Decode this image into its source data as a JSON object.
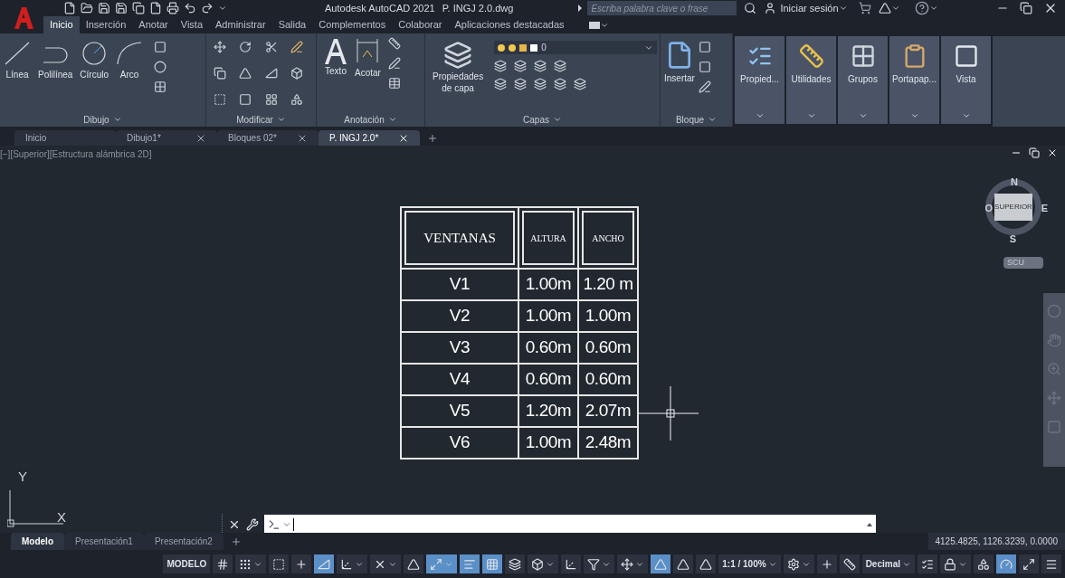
{
  "window": {
    "app_title": "Autodesk AutoCAD 2021",
    "file_name": "P. INGJ 2.0.dwg",
    "search_placeholder": "Escriba palabra clave o frase",
    "sign_in": "Iniciar sesión"
  },
  "ribbon_tabs": [
    {
      "label": "Inicio",
      "selected": true
    },
    {
      "label": "Inserción",
      "selected": false
    },
    {
      "label": "Anotar",
      "selected": false
    },
    {
      "label": "Vista",
      "selected": false
    },
    {
      "label": "Administrar",
      "selected": false
    },
    {
      "label": "Salida",
      "selected": false
    },
    {
      "label": "Complementos",
      "selected": false
    },
    {
      "label": "Colaborar",
      "selected": false
    },
    {
      "label": "Aplicaciones destacadas",
      "selected": false
    }
  ],
  "ribbon": {
    "draw_panel": {
      "title": "Dibujo",
      "tools": [
        "Línea",
        "Polilínea",
        "Círculo",
        "Arco"
      ]
    },
    "modify_panel": {
      "title": "Modificar"
    },
    "annotation_panel": {
      "title": "Anotación",
      "tools": [
        "Texto",
        "Acotar"
      ]
    },
    "layers_panel": {
      "title": "Capas",
      "tool": "Propiedades de capa",
      "current_layer": "0"
    },
    "block_panel": {
      "title": "Bloque",
      "tool": "Insertar"
    },
    "collapsed_panels": [
      "Propied...",
      "Utilidades",
      "Grupos",
      "Portapap...",
      "Vista"
    ]
  },
  "doc_tabs": [
    {
      "label": "Inicio",
      "selected": false,
      "closable": false
    },
    {
      "label": "Dibujo1*",
      "selected": false,
      "closable": true
    },
    {
      "label": "Bloques 02*",
      "selected": false,
      "closable": true
    },
    {
      "label": "P. INGJ 2.0*",
      "selected": true,
      "closable": true
    }
  ],
  "viewport": {
    "label": "[−][Superior][Estructura alámbrica 2D]",
    "compass": {
      "north": "N",
      "west": "O",
      "east": "E",
      "south": "S",
      "face": "SUPERIOR"
    },
    "ucs_button": "SCU",
    "ucs_axes": {
      "y": "Y",
      "x": "X"
    }
  },
  "table": {
    "columns": [
      "VENTANAS",
      "ALTURA",
      "ANCHO"
    ],
    "rows": [
      [
        "V1",
        "1.00m",
        "1.20 m"
      ],
      [
        "V2",
        "1.00m",
        "1.00m"
      ],
      [
        "V3",
        "0.60m",
        "0.60m"
      ],
      [
        "V4",
        "0.60m",
        "0.60m"
      ],
      [
        "V5",
        "1.20m",
        "2.07m"
      ],
      [
        "V6",
        "1.00m",
        "2.48m"
      ]
    ]
  },
  "layout_tabs": [
    {
      "label": "Modelo",
      "selected": true
    },
    {
      "label": "Presentación1",
      "selected": false
    },
    {
      "label": "Presentación2",
      "selected": false
    }
  ],
  "coordinates": "4125.4825, 1126.3239, 0.0000",
  "status_bar": [
    {
      "kind": "text",
      "label": "MODELO",
      "on": false,
      "menu": false
    },
    {
      "kind": "grid",
      "on": false,
      "menu": false
    },
    {
      "kind": "snap",
      "on": false,
      "menu": true
    },
    {
      "kind": "infer",
      "on": false,
      "menu": false
    },
    {
      "kind": "dynamic",
      "on": false,
      "menu": false
    },
    {
      "kind": "ortho",
      "on": true,
      "menu": false
    },
    {
      "kind": "polar",
      "on": false,
      "menu": true
    },
    {
      "kind": "track",
      "on": false,
      "menu": true
    },
    {
      "kind": "angle",
      "on": false,
      "menu": false
    },
    {
      "kind": "osnap",
      "on": true,
      "menu": true
    },
    {
      "kind": "lineweight",
      "on": true,
      "menu": false
    },
    {
      "kind": "transparency",
      "on": true,
      "menu": false
    },
    {
      "kind": "cycle",
      "on": false,
      "menu": false
    },
    {
      "kind": "box",
      "on": false,
      "menu": true
    },
    {
      "kind": "ucs",
      "on": false,
      "menu": false
    },
    {
      "kind": "filter",
      "on": false,
      "menu": true
    },
    {
      "kind": "gizmo",
      "on": false,
      "menu": true
    },
    {
      "kind": "annovis",
      "on": true,
      "menu": false
    },
    {
      "kind": "annoscale",
      "on": false,
      "menu": false
    },
    {
      "kind": "anno",
      "on": false,
      "menu": false
    },
    {
      "kind": "text",
      "label": "1:1 / 100%",
      "on": false,
      "menu": true
    },
    {
      "kind": "gear",
      "on": false,
      "menu": true
    },
    {
      "kind": "plus",
      "on": false,
      "menu": false
    },
    {
      "kind": "units",
      "on": false,
      "menu": false
    },
    {
      "kind": "text",
      "label": "Decimal",
      "on": false,
      "menu": true
    },
    {
      "kind": "props",
      "on": false,
      "menu": false
    },
    {
      "kind": "lock",
      "on": false,
      "menu": true
    },
    {
      "kind": "isolate",
      "on": false,
      "menu": false
    },
    {
      "kind": "accel",
      "on": true,
      "menu": false
    },
    {
      "kind": "clean",
      "on": false,
      "menu": false
    },
    {
      "kind": "menu",
      "on": false,
      "menu": false
    }
  ]
}
